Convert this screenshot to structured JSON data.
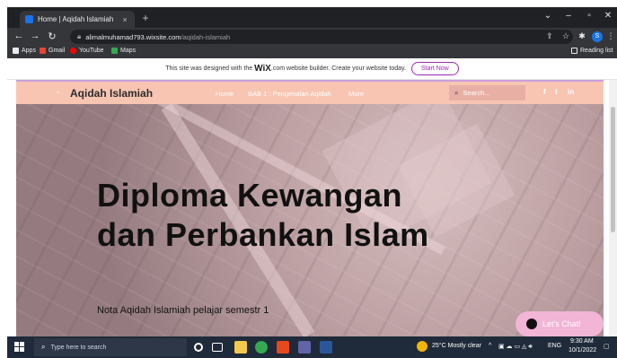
{
  "browser": {
    "tab_title": "Home | Aqidah Islamiah",
    "tab_close": "×",
    "new_tab": "+",
    "url_host": "alimalmuhamad793.wixsite.com",
    "url_path": "/aqidah-islamiah",
    "bookmarks": [
      {
        "label": "Apps",
        "color": "#e8eaed"
      },
      {
        "label": "Gmail",
        "color": "#ea4335"
      },
      {
        "label": "YouTube",
        "color": "#ff0000"
      },
      {
        "label": "Maps",
        "color": "#34a853"
      }
    ],
    "reading_list": "Reading list",
    "profile_initial": "S"
  },
  "wix_banner": {
    "text_before": "This site was designed with the",
    "logo": "WiX",
    "text_after": ".com website builder. Create your website today.",
    "cta": "Start Now"
  },
  "site": {
    "brand": "Aqidah Islamiah",
    "nav": [
      "Home",
      "BAB 1 : Pengenalan Aqidah",
      "More"
    ],
    "search_placeholder": "Search...",
    "social": [
      "f",
      "t",
      "in"
    ]
  },
  "hero": {
    "title": "Diploma Kewangan dan Perbankan Islam",
    "subtitle": "Nota Aqidah Islamiah pelajar semestr 1",
    "chat_label": "Let's Chat!"
  },
  "taskbar": {
    "search_placeholder": "Type here to search",
    "weather": "25°C  Mostly clear",
    "lang": "ENG",
    "time": "9:30 AM",
    "date": "10/1/2022"
  },
  "colors": {
    "header_bg": "#f8c5b3",
    "accent_purple": "#9a2ab0",
    "chat_bg": "#f3b5d6",
    "taskbar_bg": "#1f2a3a"
  }
}
